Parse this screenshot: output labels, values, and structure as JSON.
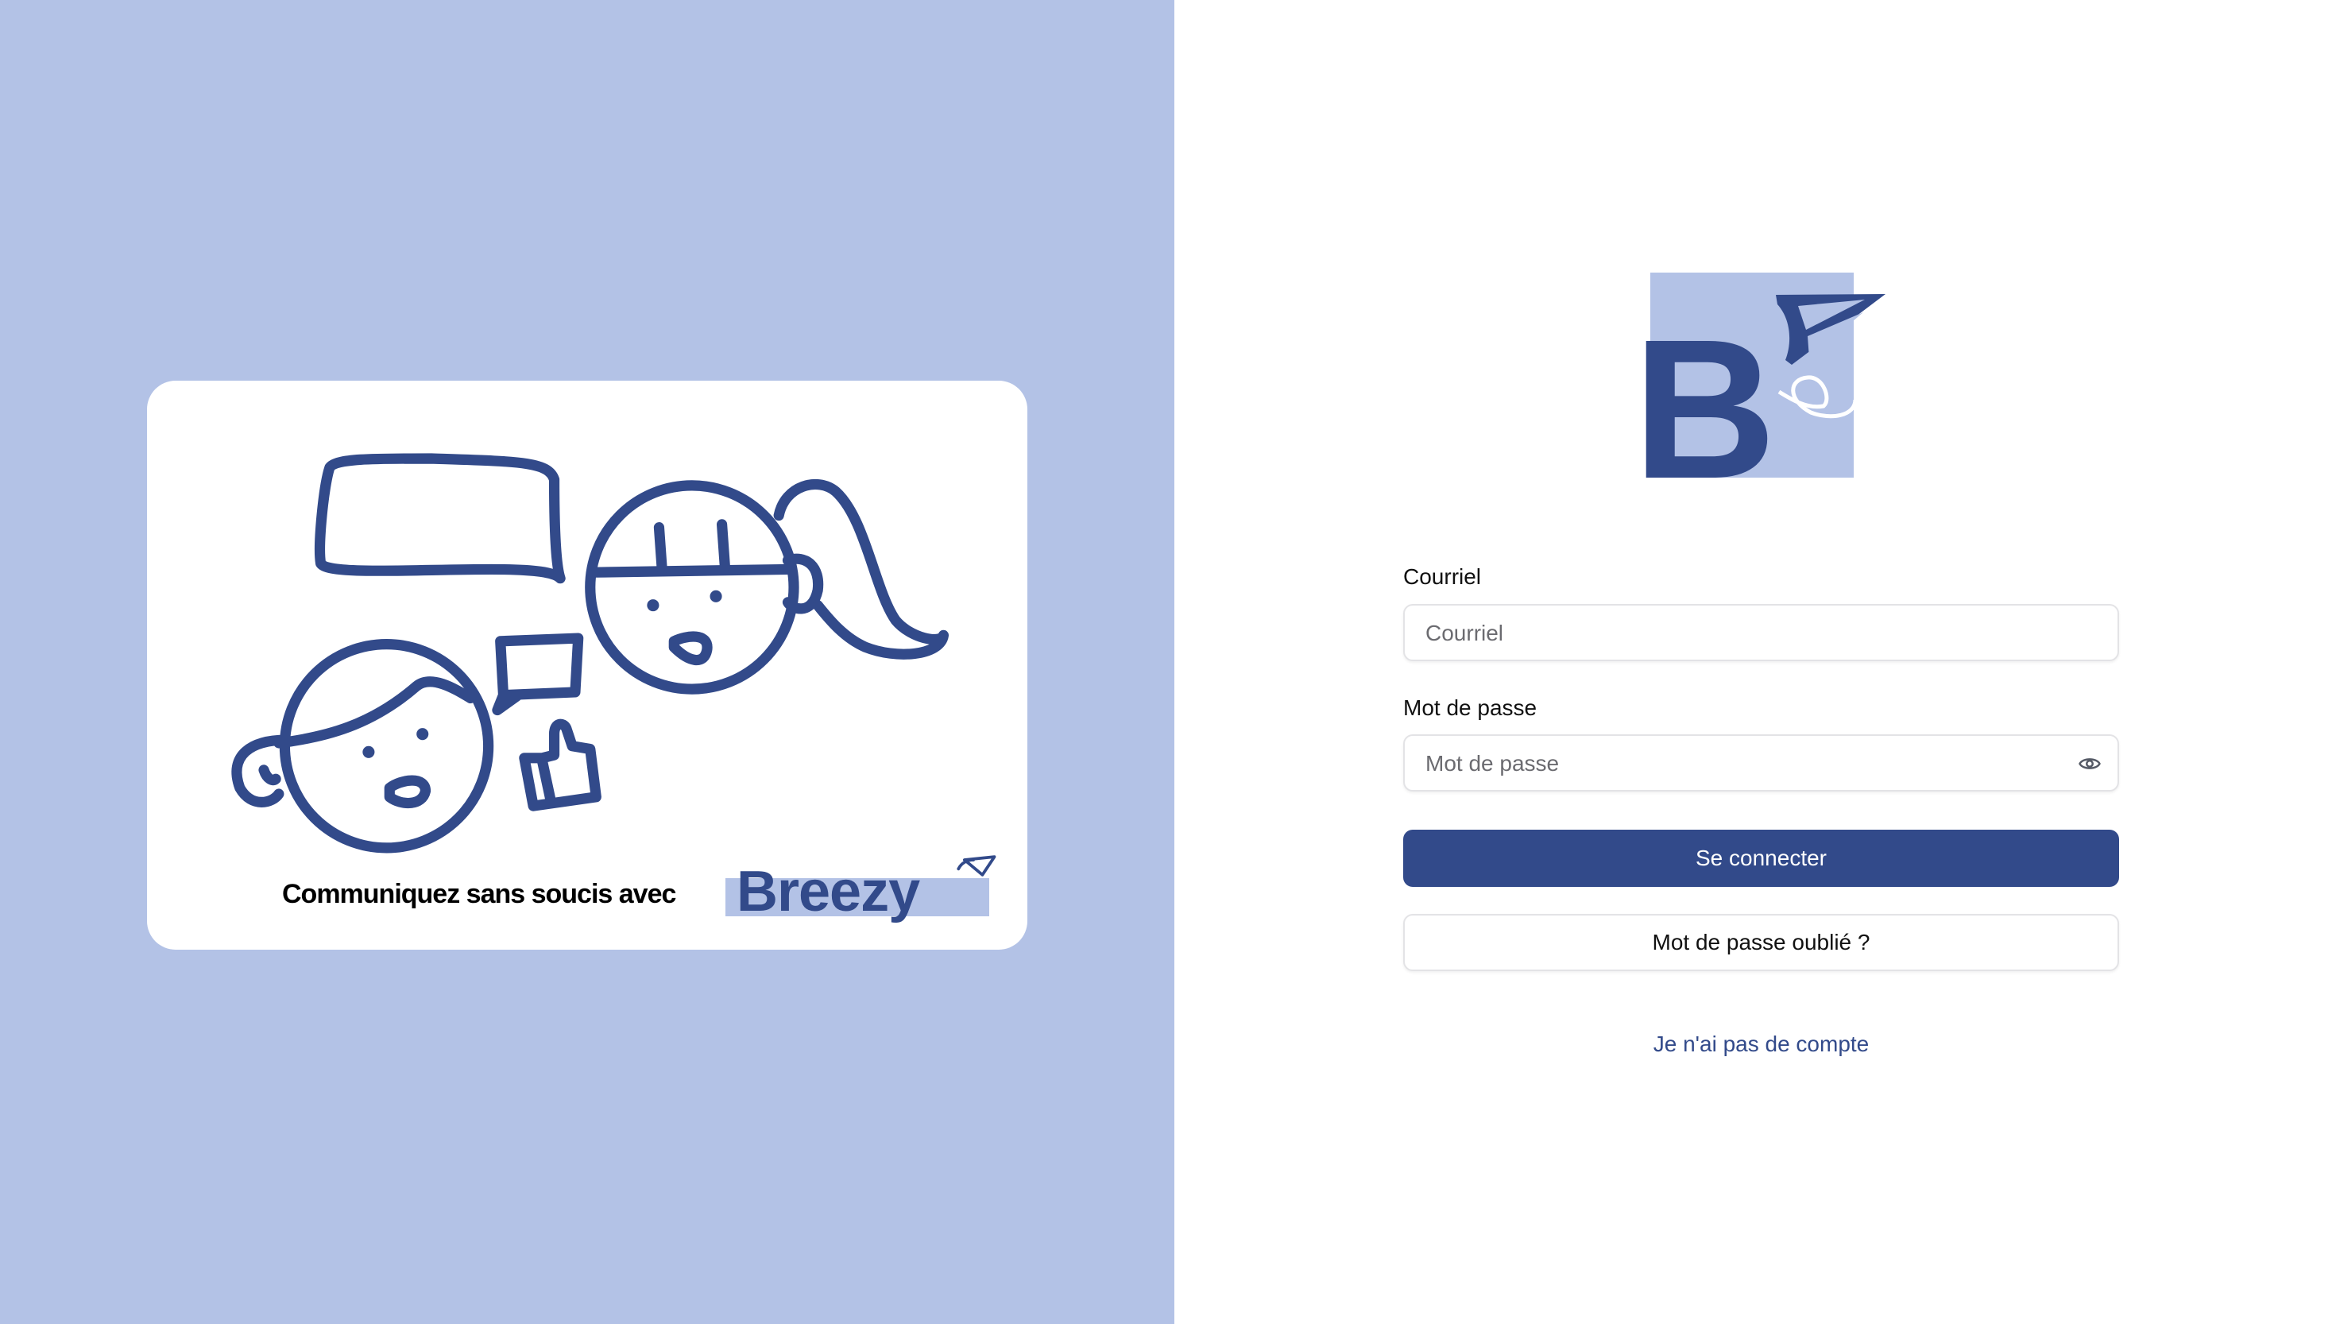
{
  "colors": {
    "brand": "#324a8a",
    "brand_light": "#b3c2e6",
    "background": "#ffffff"
  },
  "illustration": {
    "tagline": "Communiquez sans soucis avec",
    "brand": "Breezy"
  },
  "logo": {
    "letter": "B"
  },
  "form": {
    "email": {
      "label": "Courriel",
      "placeholder": "Courriel",
      "value": ""
    },
    "password": {
      "label": "Mot de passe",
      "placeholder": "Mot de passe",
      "value": "",
      "toggle_icon": "eye-icon"
    },
    "submit_label": "Se connecter",
    "forgot_label": "Mot de passe oublié ?",
    "signup_link": "Je n'ai pas de compte"
  }
}
